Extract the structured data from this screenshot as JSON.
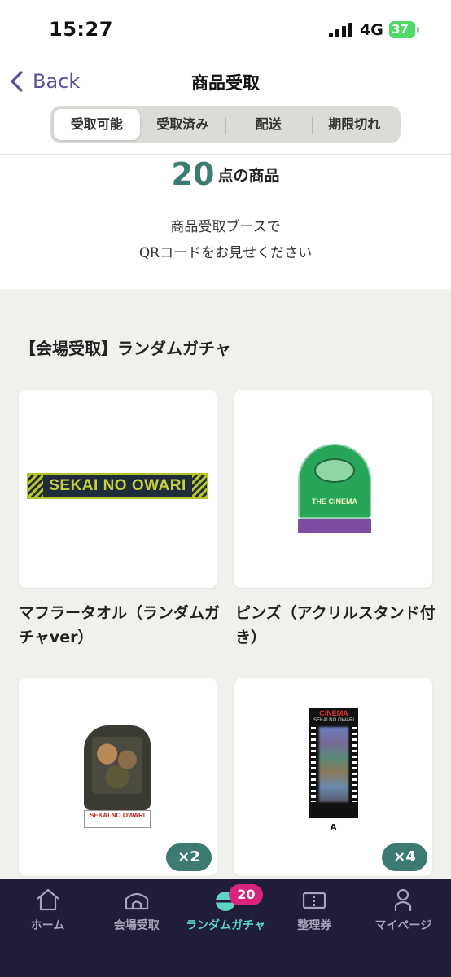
{
  "status_bar": {
    "time": "15:27",
    "network": "4G",
    "battery": "37"
  },
  "nav": {
    "back_label": "Back",
    "title": "商品受取"
  },
  "tabs": [
    {
      "label": "受取可能",
      "active": true
    },
    {
      "label": "受取済み",
      "active": false
    },
    {
      "label": "配送",
      "active": false
    },
    {
      "label": "期限切れ",
      "active": false
    }
  ],
  "summary": {
    "count": "20",
    "count_unit": "点の商品",
    "line1": "商品受取ブースで",
    "line2": "QRコードをお見せください"
  },
  "section": {
    "title": "【会場受取】ランダムガチャ"
  },
  "products": [
    {
      "name": "マフラータオル（ランダムガチャver）",
      "art_text": "SEKAI NO OWARI",
      "quantity": null,
      "icon": "towel-image"
    },
    {
      "name": "ピンズ（アクリルスタンド付き）",
      "art_text": "THE CINEMA",
      "quantity": null,
      "icon": "pins-image"
    },
    {
      "name": "",
      "art_text": "SEKAI NO OWARI",
      "quantity": "×2",
      "icon": "acrylic-stand-image"
    },
    {
      "name": "",
      "art_text": "CINEMA",
      "art_subtext": "SEKAI NO OWARI",
      "art_letter": "A",
      "quantity": "×4",
      "icon": "film-strip-image"
    }
  ],
  "bottom_tabs": [
    {
      "label": "ホーム",
      "icon": "home-icon",
      "active": false
    },
    {
      "label": "会場受取",
      "icon": "venue-icon",
      "active": false
    },
    {
      "label": "ランダムガチャ",
      "icon": "gacha-icon",
      "active": true,
      "badge": "20"
    },
    {
      "label": "整理券",
      "icon": "ticket-icon",
      "active": false
    },
    {
      "label": "マイページ",
      "icon": "person-icon",
      "active": false
    }
  ],
  "colors": {
    "accent": "#3c7a72",
    "tab_bar": "#201d38",
    "badge": "#d8257b",
    "back": "#5b4f9a",
    "active_tab": "#5fd3c0"
  }
}
